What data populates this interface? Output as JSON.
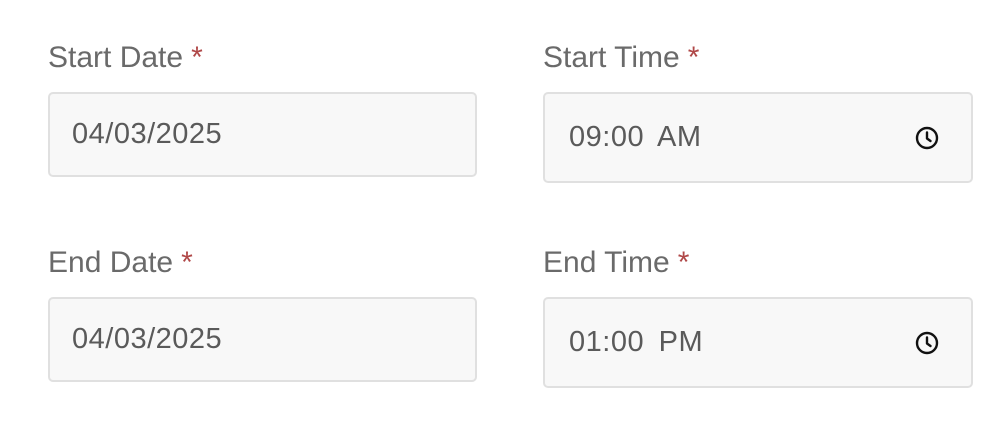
{
  "form": {
    "start_date": {
      "label": "Start Date",
      "required_marker": "*",
      "value": "04/03/2025"
    },
    "start_time": {
      "label": "Start Time",
      "required_marker": "*",
      "value": "09:00 AM",
      "icon": "clock-icon"
    },
    "end_date": {
      "label": "End Date",
      "required_marker": "*",
      "value": "04/03/2025"
    },
    "end_time": {
      "label": "End Time",
      "required_marker": "*",
      "value": "01:00 PM",
      "icon": "clock-icon"
    }
  },
  "colors": {
    "required": "#b04848",
    "field_background": "#f8f8f8",
    "field_border": "#e0e0e0",
    "label_text": "#6a6a6a"
  }
}
